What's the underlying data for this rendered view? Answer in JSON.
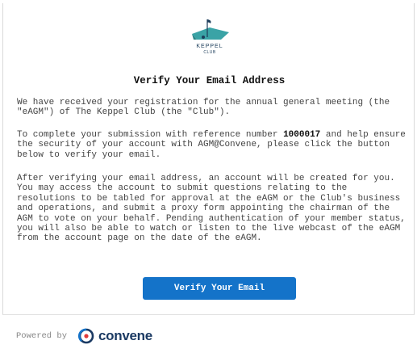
{
  "email": {
    "heading": "Verify Your Email Address",
    "p1": "We have received your registration for the annual general meeting (the \"eAGM\") of The Keppel Club (the \"Club\").",
    "p2_prefix": "To complete your submission with reference number ",
    "reference_number": "1000017",
    "p2_suffix": " and help ensure the security of your account with AGM@Convene, please click the button below to verify your email.",
    "p3": "After verifying your email address, an account will be created for you. You may access the account to submit questions relating to the resolutions to be tabled for approval at the eAGM or the Club's business and operations, and submit a proxy form appointing the chairman of the AGM to vote on your behalf. Pending authentication of your member status, you will also be able to watch or listen to the live webcast of the eAGM from the account page on the date of the eAGM.",
    "button_label": "Verify Your Email"
  },
  "logo": {
    "line1": "KEPPEL",
    "line2": "CLUB",
    "icon": "golf-flag-logo"
  },
  "footer": {
    "powered_by": "Powered by",
    "brand": "convene",
    "icon": "convene-logo-icon"
  },
  "colors": {
    "button": "#1473c9",
    "logo_teal": "#3aa3a6",
    "brand_navy": "#1b3a63"
  }
}
